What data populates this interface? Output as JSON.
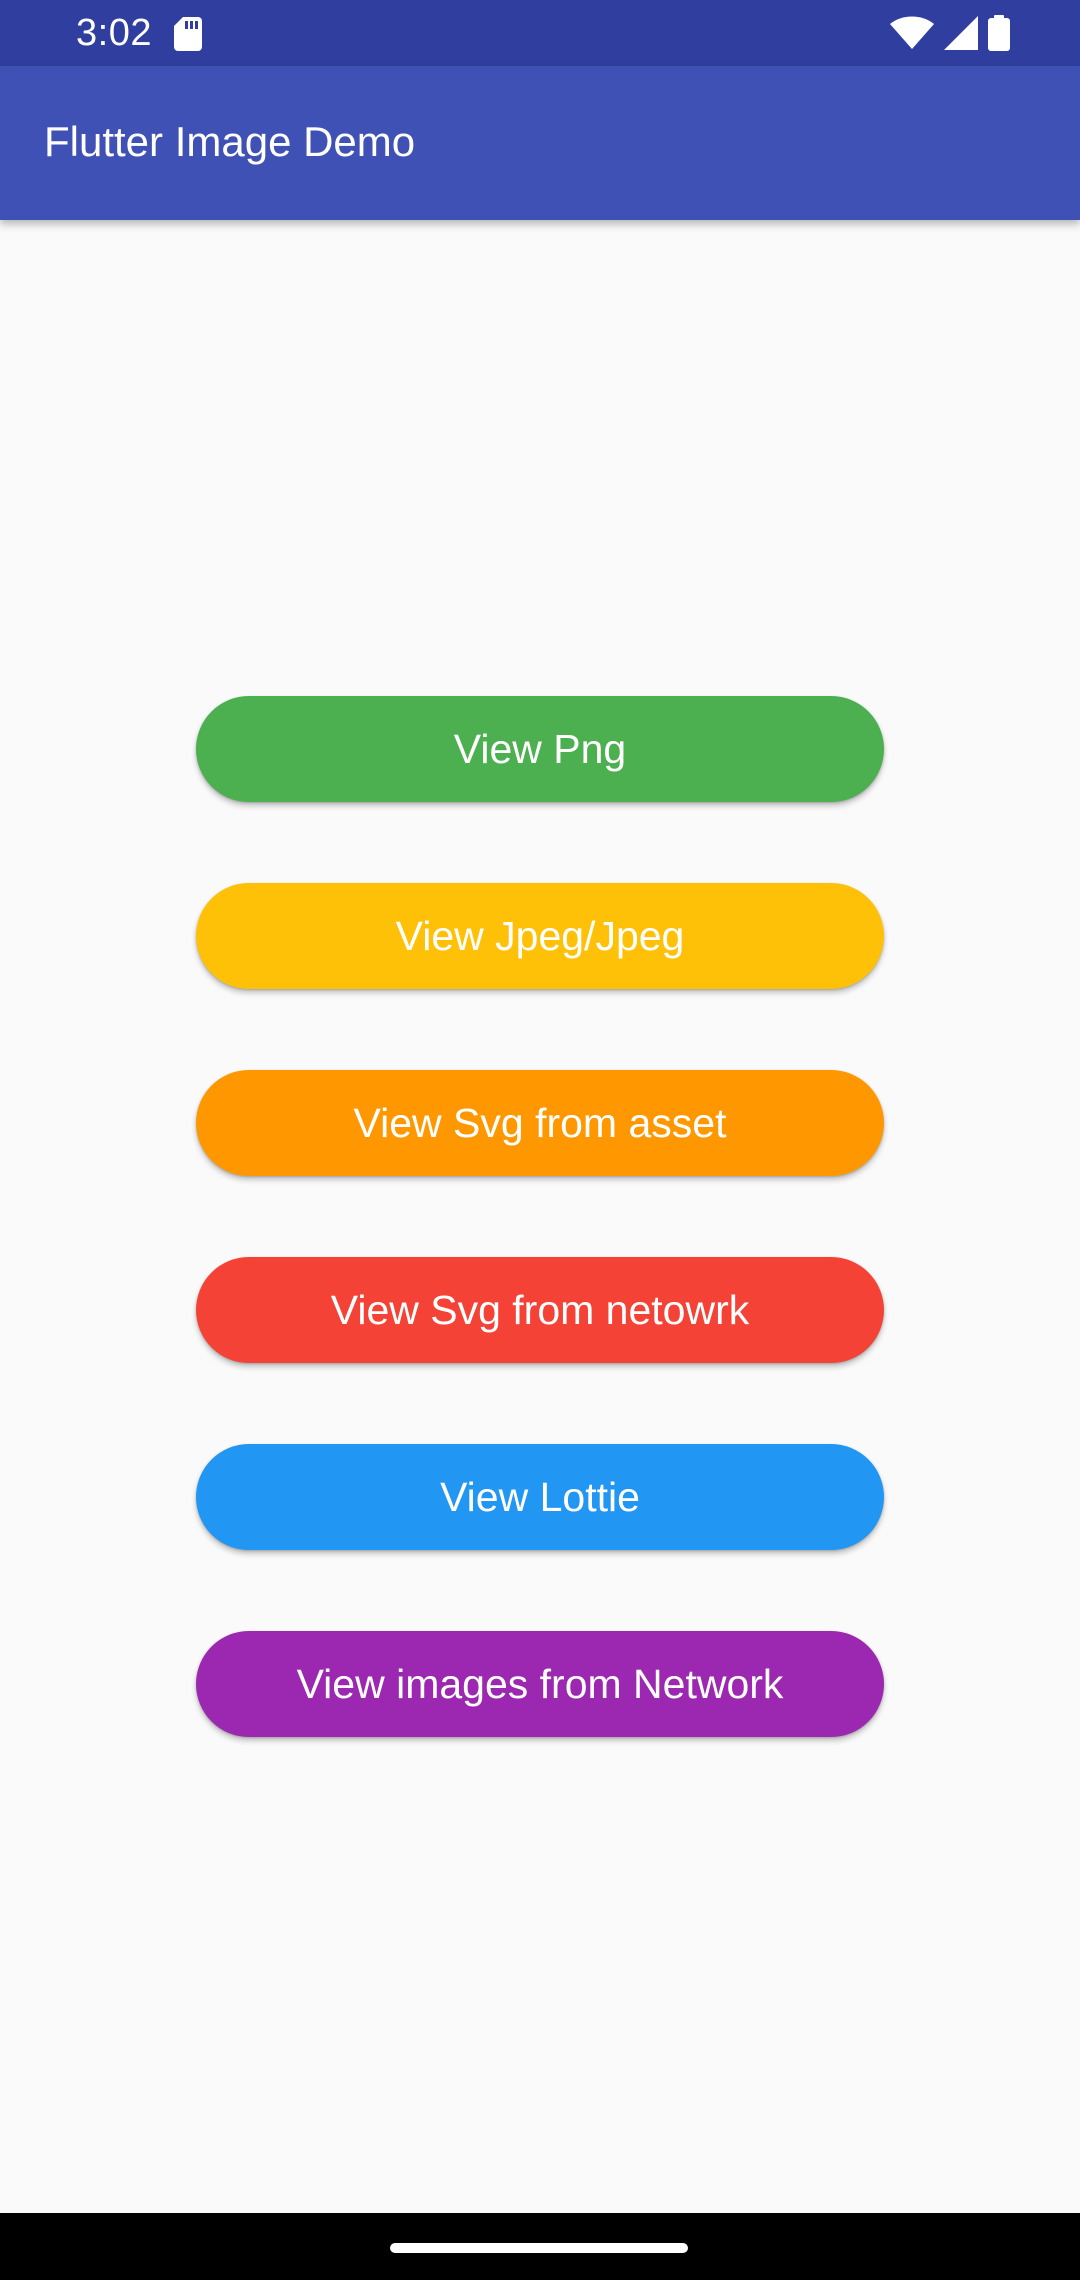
{
  "status_bar": {
    "time": "3:02",
    "icons": [
      "sd-card-icon",
      "wifi-icon",
      "signal-icon",
      "battery-icon"
    ]
  },
  "app_bar": {
    "title": "Flutter Image Demo",
    "color": "#3f51b5"
  },
  "buttons": [
    {
      "label": "View Png",
      "color": "#4caf50"
    },
    {
      "label": "View Jpeg/Jpeg",
      "color": "#ffc107"
    },
    {
      "label": "View Svg from asset",
      "color": "#ff9800"
    },
    {
      "label": "View Svg from netowrk",
      "color": "#f44336"
    },
    {
      "label": "View Lottie",
      "color": "#2196f3"
    },
    {
      "label": "View images from Network",
      "color": "#9c27b0"
    }
  ]
}
